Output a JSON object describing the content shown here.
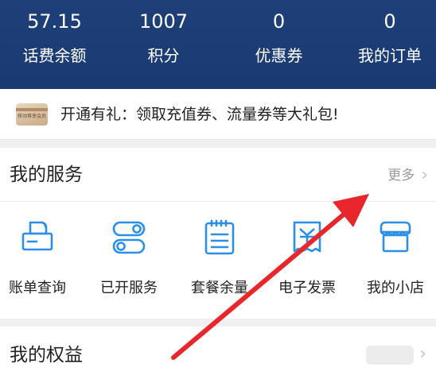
{
  "stats": [
    {
      "value": "57.15",
      "label": "话费余额"
    },
    {
      "value": "1007",
      "label": "积分"
    },
    {
      "value": "0",
      "label": "优惠券"
    },
    {
      "value": "0",
      "label": "我的订单"
    }
  ],
  "promo": {
    "card_text": "移动尊享会员",
    "text": "开通有礼：领取充值券、流量券等大礼包!"
  },
  "services": {
    "title": "我的服务",
    "more_label": "更多",
    "items": [
      {
        "label": "账单查询",
        "icon": "printer-bill-icon"
      },
      {
        "label": "已开服务",
        "icon": "toggle-switches-icon"
      },
      {
        "label": "套餐余量",
        "icon": "notepad-icon"
      },
      {
        "label": "电子发票",
        "icon": "invoice-receipt-icon"
      },
      {
        "label": "我的小店",
        "icon": "store-icon"
      }
    ]
  },
  "rights": {
    "title": "我的权益"
  },
  "colors": {
    "header_bg": "#1e3f78",
    "icon_blue": "#2b8fe8",
    "arrow_red": "#e8262b"
  }
}
